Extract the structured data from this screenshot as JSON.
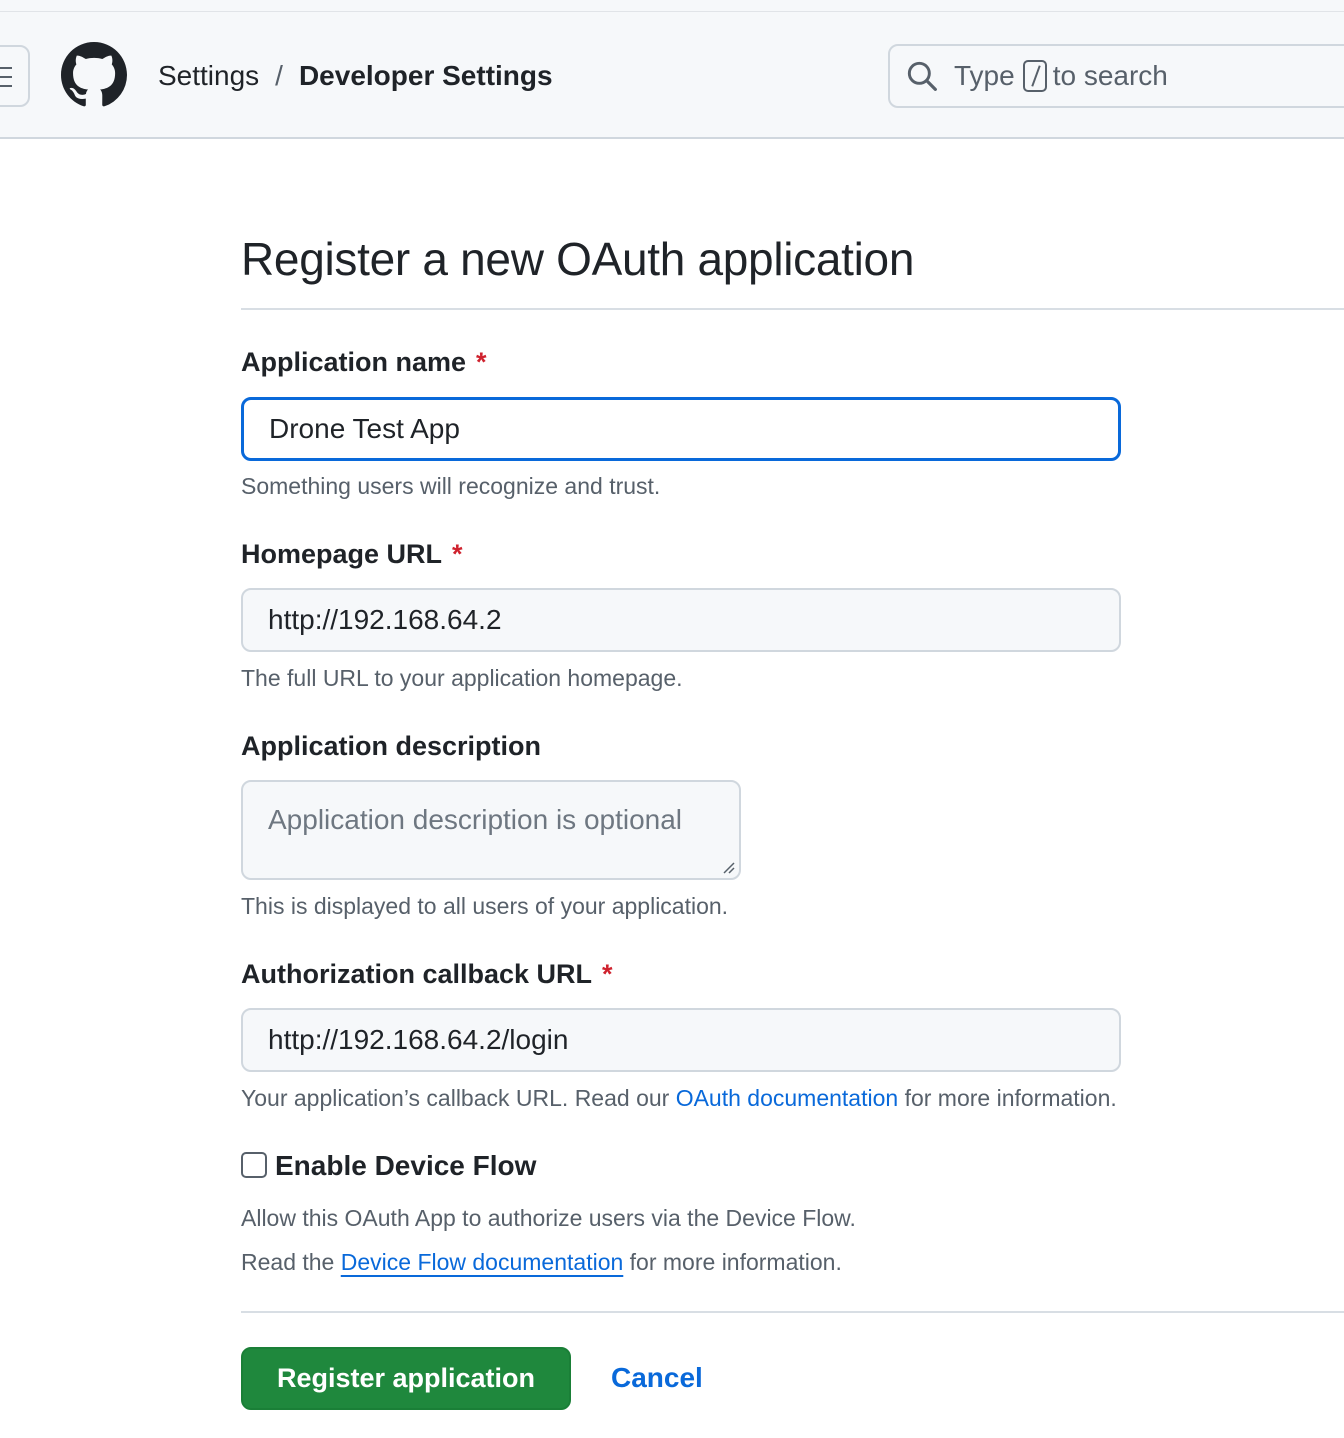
{
  "header": {
    "breadcrumb": {
      "settings": "Settings",
      "separator": "/",
      "current": "Developer Settings"
    },
    "search": {
      "prefix": "Type",
      "suffix": "to search"
    }
  },
  "form": {
    "title": "Register a new OAuth application",
    "fields": {
      "app_name": {
        "label": "Application name",
        "required_mark": "*",
        "value": "Drone Test App",
        "hint": "Something users will recognize and trust."
      },
      "homepage_url": {
        "label": "Homepage URL",
        "required_mark": "*",
        "value": "http://192.168.64.2",
        "hint": "The full URL to your application homepage."
      },
      "description": {
        "label": "Application description",
        "placeholder": "Application description is optional",
        "hint": "This is displayed to all users of your application."
      },
      "callback_url": {
        "label": "Authorization callback URL",
        "required_mark": "*",
        "value": "http://192.168.64.2/login",
        "hint_before": "Your application’s callback URL. Read our",
        "hint_link": "OAuth documentation",
        "hint_after": "for more information."
      }
    },
    "device_flow": {
      "label": "Enable Device Flow",
      "checked": false,
      "line1": "Allow this OAuth App to authorize users via the Device Flow.",
      "line2_before": "Read the",
      "line2_link": "Device Flow documentation",
      "line2_after": "for more information."
    },
    "actions": {
      "submit": "Register application",
      "cancel": "Cancel"
    }
  },
  "colors": {
    "primary": "#1f883d",
    "link": "#0969da",
    "focus": "#0969da",
    "required": "#cf222e"
  },
  "icons": [
    "menu-icon",
    "github-logo-icon",
    "search-icon",
    "resize-grip-icon"
  ]
}
